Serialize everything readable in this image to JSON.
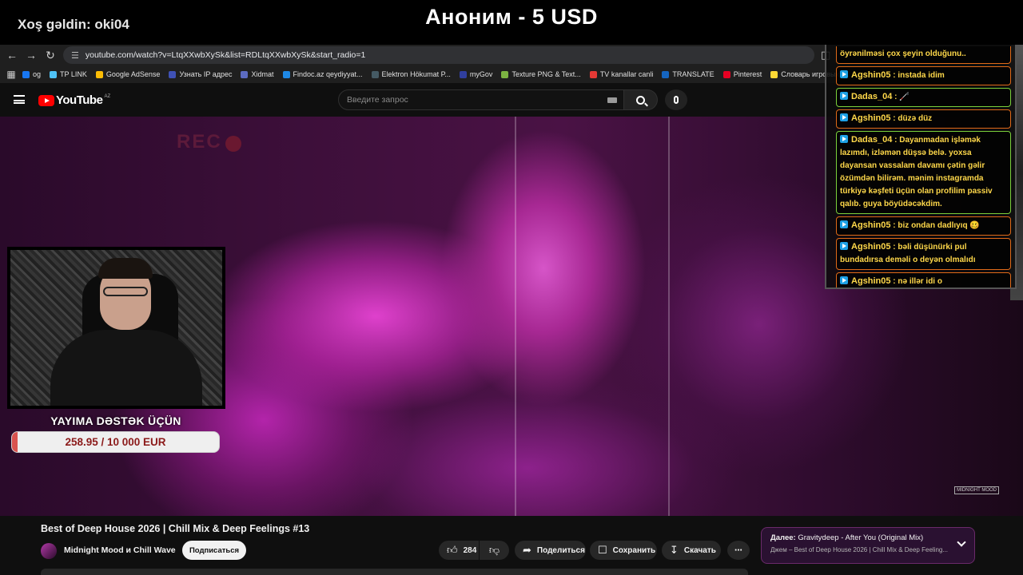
{
  "overlay": {
    "welcome": "Xoş gəldin: oki04",
    "donation_alert": "Аноним - 5 USD",
    "support_title": "YAYIMA DƏSTƏK ÜÇÜN",
    "goal_text": "258.95 / 10 000 EUR",
    "goal_progress": 0.026,
    "goal_fill_color": "#d9534f",
    "rec_label": "REC"
  },
  "browser": {
    "url": "youtube.com/watch?v=LtqXXwbXySk&list=RDLtqXXwbXySk&start_radio=1",
    "back_icon": "arrow-left-icon",
    "forward_icon": "arrow-right-icon",
    "reload_icon": "reload-icon",
    "bookmarks": [
      {
        "label": "og",
        "color": "#1877f2"
      },
      {
        "label": "TP LINK",
        "color": "#4fc3f7"
      },
      {
        "label": "Google AdSense",
        "color": "#fbbc05"
      },
      {
        "label": "Узнать IP адрес",
        "color": "#3f51b5"
      },
      {
        "label": "Xidmat",
        "color": "#5c6bc0"
      },
      {
        "label": "Findoc.az qeydiyyat...",
        "color": "#1e88e5"
      },
      {
        "label": "Elektron Hökumat P...",
        "color": "#455a64"
      },
      {
        "label": "myGov",
        "color": "#303f9f"
      },
      {
        "label": "Texture PNG & Text...",
        "color": "#7cb342"
      },
      {
        "label": "TV kanallar canli",
        "color": "#e53935"
      },
      {
        "label": "TRANSLATE",
        "color": "#1565c0"
      },
      {
        "label": "Pinterest",
        "color": "#e60023"
      },
      {
        "label": "Словарь игровых т...",
        "color": "#fdd835"
      }
    ]
  },
  "youtube": {
    "logo_text": "YouTube",
    "region": "AZ",
    "search_placeholder": "Введите запрос",
    "video_title": "Best of Deep House 2026 | Chill Mix & Deep Feelings #13",
    "channel_name": "Midnight Mood и Chill Wave",
    "subscribe_label": "Подписаться",
    "like_count": "284",
    "share_label": "Поделиться",
    "save_label": "Сохранить",
    "download_label": "Скачать",
    "next_prefix": "Далее:",
    "next_title": "Gravitydeep - After You (Original Mix)",
    "next_subtitle": "Джем – Best of Deep House 2026 | Chill Mix & Deep Feeling...",
    "watermark": "MIDNIGHT MOOD"
  },
  "chat": {
    "messages": [
      {
        "user": "",
        "text": "öyrənilməsi çox şeyin olduğunu..",
        "style": "orange first"
      },
      {
        "user": "Agshin05",
        "text": "instada idim",
        "style": "orange"
      },
      {
        "user": "Dadas_04",
        "text": "🦯",
        "style": "green"
      },
      {
        "user": "Agshin05",
        "text": "düzə düz",
        "style": "orange"
      },
      {
        "user": "Dadas_04",
        "text": "Dayanmadan işləmək lazımdı, izləmən düşsə belə. yoxsa dayansan vassalam davamı çətin gəlir özümdən bilirəm. mənim instagramda türkiyə kəşfeti üçün olan profilim passiv qalıb. guya böyüdəcəkdim.",
        "style": "green"
      },
      {
        "user": "Agshin05",
        "text": "biz ondan dadlıyıq 🥴",
        "style": "orange"
      },
      {
        "user": "Agshin05",
        "text": "bəli düşünürki pul bundadırsa deməli o deyən olmalıdı",
        "style": "orange"
      },
      {
        "user": "Agshin05",
        "text": "nə illər idi o illər..Doymuşduq Rap ə",
        "style": "orange"
      }
    ]
  }
}
